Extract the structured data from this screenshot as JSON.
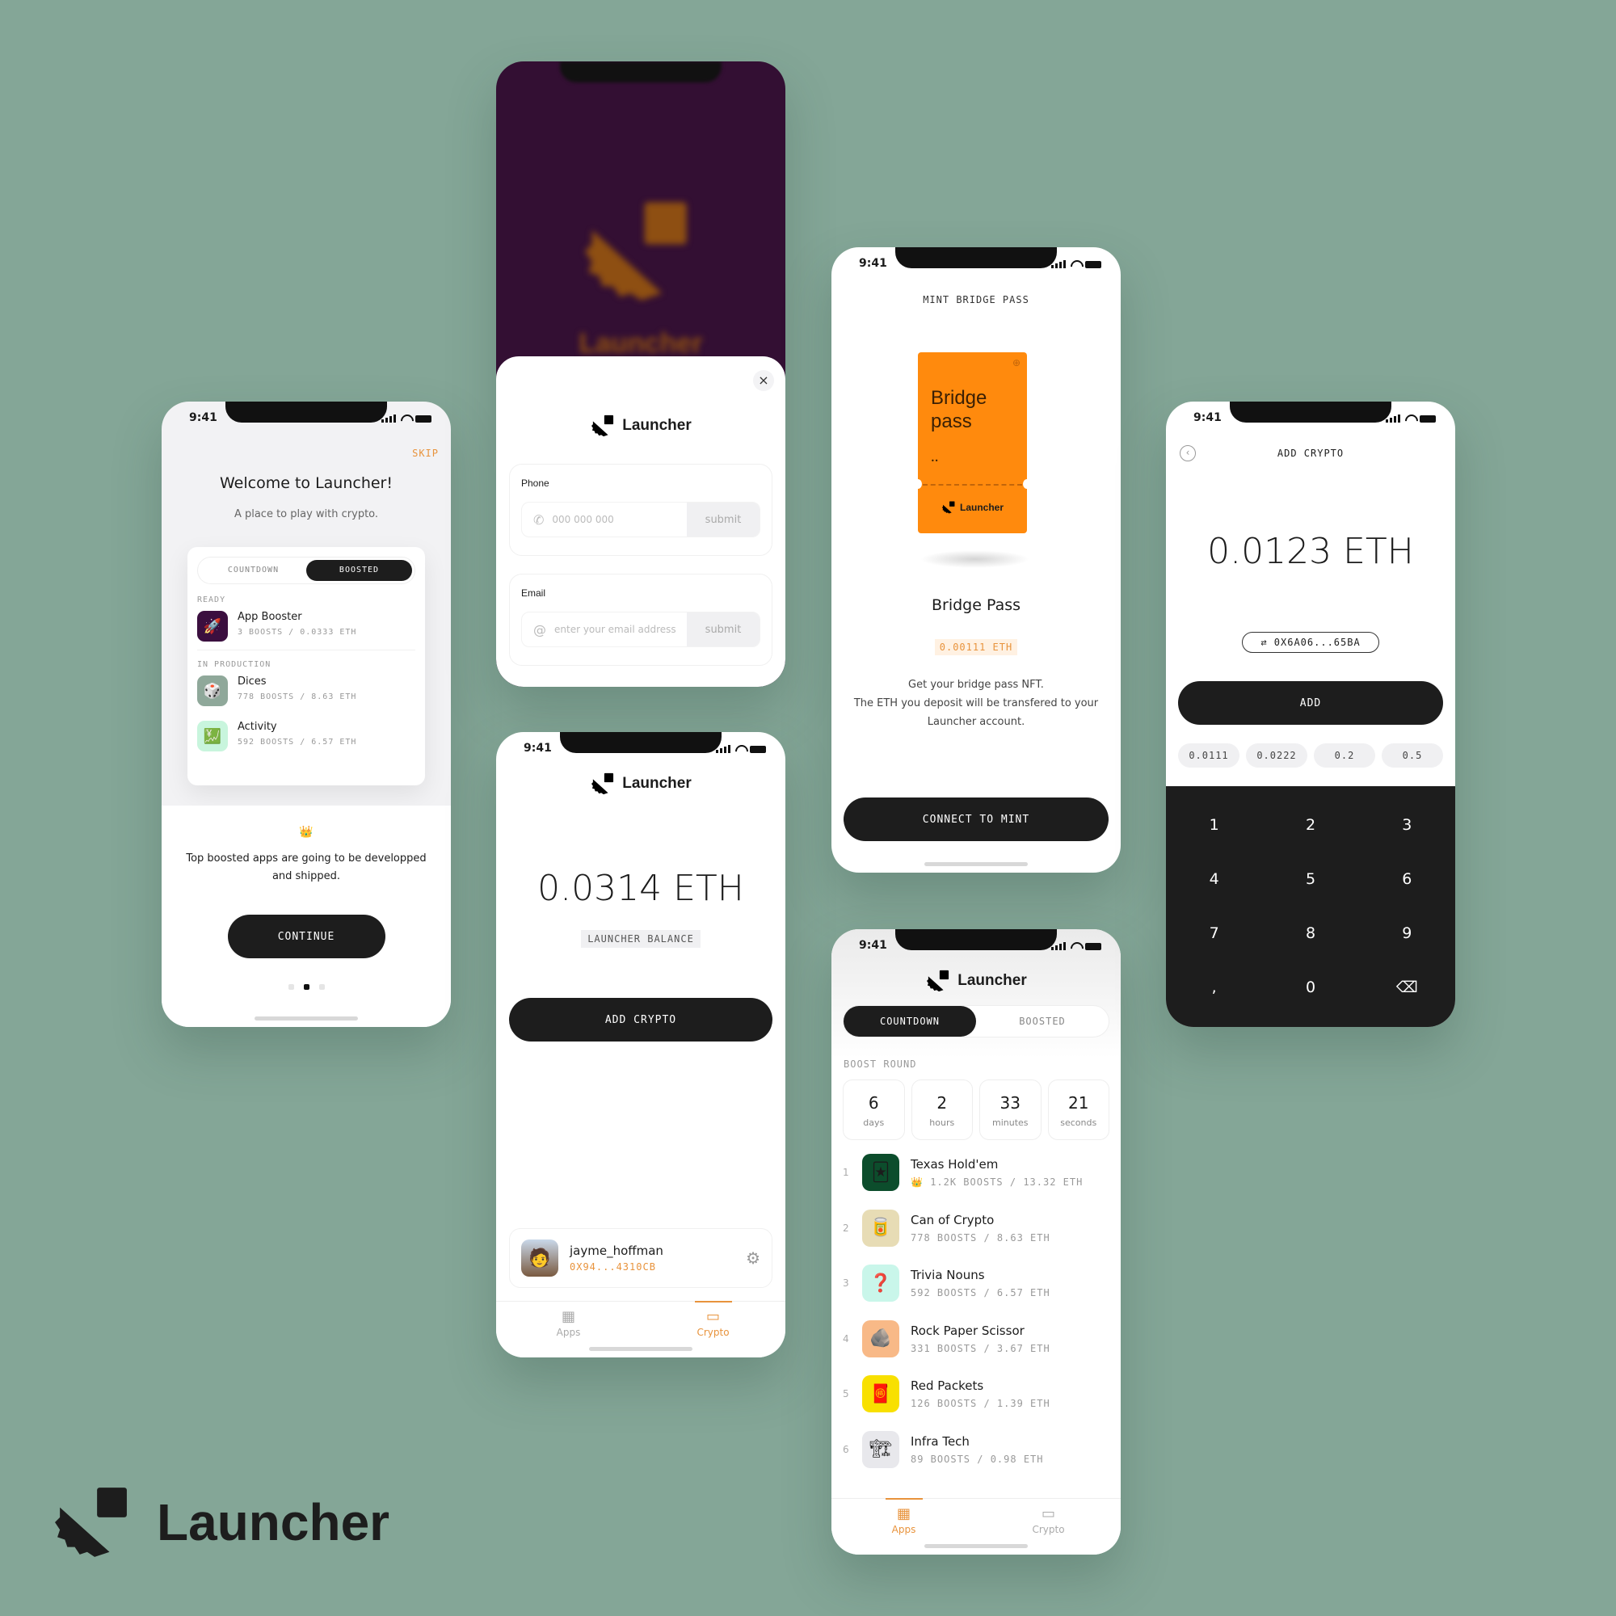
{
  "status_time": "9:41",
  "brand": {
    "name": "Launcher",
    "accent": "#e8933c",
    "dark": "#1d1d1d",
    "bg": "#84a697",
    "splash_bg": "#330f33",
    "splash_logo": "#8e4f12"
  },
  "onboarding": {
    "skip": "SKIP",
    "title": "Welcome to Launcher!",
    "subtitle": "A place to play with crypto.",
    "tabs": [
      "COUNTDOWN",
      "BOOSTED"
    ],
    "active_tab": "BOOSTED",
    "ready_label": "READY",
    "ready_items": [
      {
        "name": "App Booster",
        "meta": "3 BOOSTS / 0.0333 ETH",
        "icon": "rocket-icon",
        "glyph": "🚀",
        "color": "#3b0f3f"
      }
    ],
    "production_label": "IN PRODUCTION",
    "production_items": [
      {
        "name": "Dices",
        "meta": "778 BOOSTS / 8.63 ETH",
        "icon": "dice-icon",
        "glyph": "🎲",
        "color": "#8fa89a"
      },
      {
        "name": "Activity",
        "meta": "592 BOOSTS / 6.57 ETH",
        "icon": "chart-icon",
        "glyph": "💹",
        "color": "#c8f5dd"
      }
    ],
    "crown": "👑",
    "description": "Top boosted apps are going to be developped and shipped.",
    "continue": "CONTINUE",
    "page": 2,
    "pages": 3
  },
  "login": {
    "close": "×",
    "phone_label": "Phone",
    "phone_placeholder": "000 000 000",
    "email_label": "Email",
    "email_placeholder": "enter your email address",
    "submit": "submit",
    "splash_text": "Launcher"
  },
  "wallet": {
    "balance": "0.0314 ETH",
    "balance_label": "LAUNCHER BALANCE",
    "add_crypto": "ADD CRYPTO",
    "username": "jayme_hoffman",
    "address": "0X94...4310CB",
    "tabs": [
      {
        "label": "Apps",
        "icon": "apps-icon"
      },
      {
        "label": "Crypto",
        "icon": "wallet-icon"
      }
    ],
    "active_tab": "Crypto"
  },
  "mint": {
    "header": "MINT BRIDGE PASS",
    "card_title": "Bridge pass",
    "card_brand": "Launcher",
    "title": "Bridge Pass",
    "price": "0.00111 ETH",
    "desc1": "Get your bridge pass NFT.",
    "desc2": "The ETH you deposit will be transfered to your Launcher account.",
    "button": "CONNECT TO MINT"
  },
  "leaderboard": {
    "tabs": [
      "COUNTDOWN",
      "BOOSTED"
    ],
    "active_tab": "COUNTDOWN",
    "round_label": "BOOST ROUND",
    "countdown": [
      {
        "value": "6",
        "unit": "days"
      },
      {
        "value": "2",
        "unit": "hours"
      },
      {
        "value": "33",
        "unit": "minutes"
      },
      {
        "value": "21",
        "unit": "seconds"
      }
    ],
    "apps": [
      {
        "rank": "1",
        "name": "Texas Hold'em",
        "meta": "1.2K BOOSTS / 13.32 ETH",
        "crown": true,
        "glyph": "🃏",
        "color": "#0c4d2c"
      },
      {
        "rank": "2",
        "name": "Can of Crypto",
        "meta": "778 BOOSTS / 8.63 ETH",
        "crown": false,
        "glyph": "🥫",
        "color": "#e7dcb5"
      },
      {
        "rank": "3",
        "name": "Trivia Nouns",
        "meta": "592 BOOSTS / 6.57 ETH",
        "crown": false,
        "glyph": "❓",
        "color": "#c9f6ea"
      },
      {
        "rank": "4",
        "name": "Rock Paper Scissor",
        "meta": "331 BOOSTS / 3.67 ETH",
        "crown": false,
        "glyph": "🪨",
        "color": "#f8b987"
      },
      {
        "rank": "5",
        "name": "Red Packets",
        "meta": "126 BOOSTS / 1.39 ETH",
        "crown": false,
        "glyph": "🧧",
        "color": "#f8e000"
      },
      {
        "rank": "6",
        "name": "Infra Tech",
        "meta": "89 BOOSTS / 0.98 ETH",
        "crown": false,
        "glyph": "🏗",
        "color": "#e8e8ec"
      }
    ],
    "tabs_bottom": [
      {
        "label": "Apps"
      },
      {
        "label": "Crypto"
      }
    ],
    "active_bottom": "Apps"
  },
  "add_crypto": {
    "header": "ADD CRYPTO",
    "amount": "0.0123 ETH",
    "address": "0X6A06...65BA",
    "add": "ADD",
    "presets": [
      "0.0111",
      "0.0222",
      "0.2",
      "0.5"
    ],
    "keys": [
      "1",
      "2",
      "3",
      "4",
      "5",
      "6",
      "7",
      "8",
      "9",
      ",",
      "0",
      "⌫"
    ]
  },
  "footer_brand": "Launcher"
}
